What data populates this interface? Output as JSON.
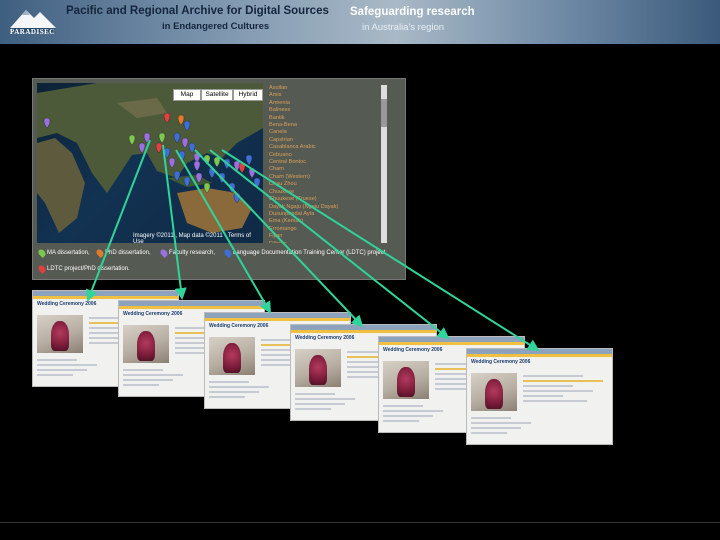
{
  "header": {
    "logo_text": "PARADISEC",
    "title_line1": "Pacific and Regional Archive for Digital Sources",
    "title_line2": "in Endangered Cultures",
    "tagline1": "Safeguarding research",
    "tagline2": "in Australia's region"
  },
  "map": {
    "buttons": [
      "Map",
      "Satellite",
      "Hybrid"
    ],
    "imagery_text": "Imagery ©2011 , Map data ©2011 - Terms of Use",
    "languages": [
      "Asuilan",
      "Amis",
      "Armenia",
      "Balinese",
      "Bantik",
      "Bena-Bena",
      "Canela",
      "Capstrian",
      "Casablanca Arabic",
      "Cebuano",
      "Central Bontoc",
      "Cham",
      "Cham (Western)",
      "Chau Zhou",
      "Chuukese",
      "Chuukese (Truese)",
      "Dayak Ngaju (Ngaju Dayak)",
      "Dusunpandai Ayta",
      "Ema (Kemak)",
      "Erromango",
      "Fijian",
      "Filipino",
      "Fijian",
      "Gagil"
    ]
  },
  "legend": [
    {
      "label": "MA dissertation,",
      "color": "#7ec850"
    },
    {
      "label": "PhD dissertation,",
      "color": "#e07a2e"
    },
    {
      "label": "Faculty research,",
      "color": "#9a6fe0"
    },
    {
      "label": "Language Documentation Training Center (LDTC) project,",
      "color": "#3e6fd8"
    },
    {
      "label": "LDTC project/PhD dissertation.",
      "color": "#e04040"
    }
  ],
  "screenshots": {
    "title": "Wedding Ceremony 2006"
  },
  "colors": {
    "arrow": "#2fd49a",
    "background": "#000000"
  }
}
